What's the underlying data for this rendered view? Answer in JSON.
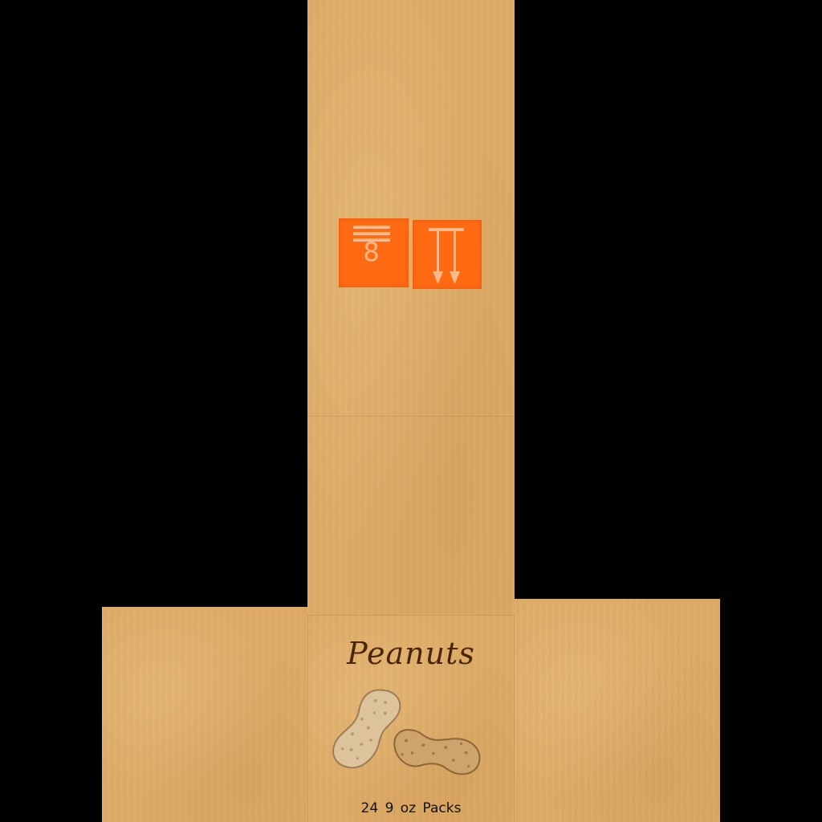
{
  "carton": {
    "product_name": "Peanuts",
    "pack_count": "24 9 oz Packs",
    "stack_limit_digit": "8",
    "symbols": [
      {
        "icon": "stack-limit-icon",
        "color": "#ff6a12"
      },
      {
        "icon": "this-way-up-arrows-icon",
        "color": "#ff6a12"
      }
    ],
    "artwork_icon": "peanut-shells-icon",
    "colors": {
      "cardboard": "#dcaa66",
      "background": "#000000",
      "title_text": "#4a2608",
      "symbol_orange": "#ff6a12"
    }
  }
}
